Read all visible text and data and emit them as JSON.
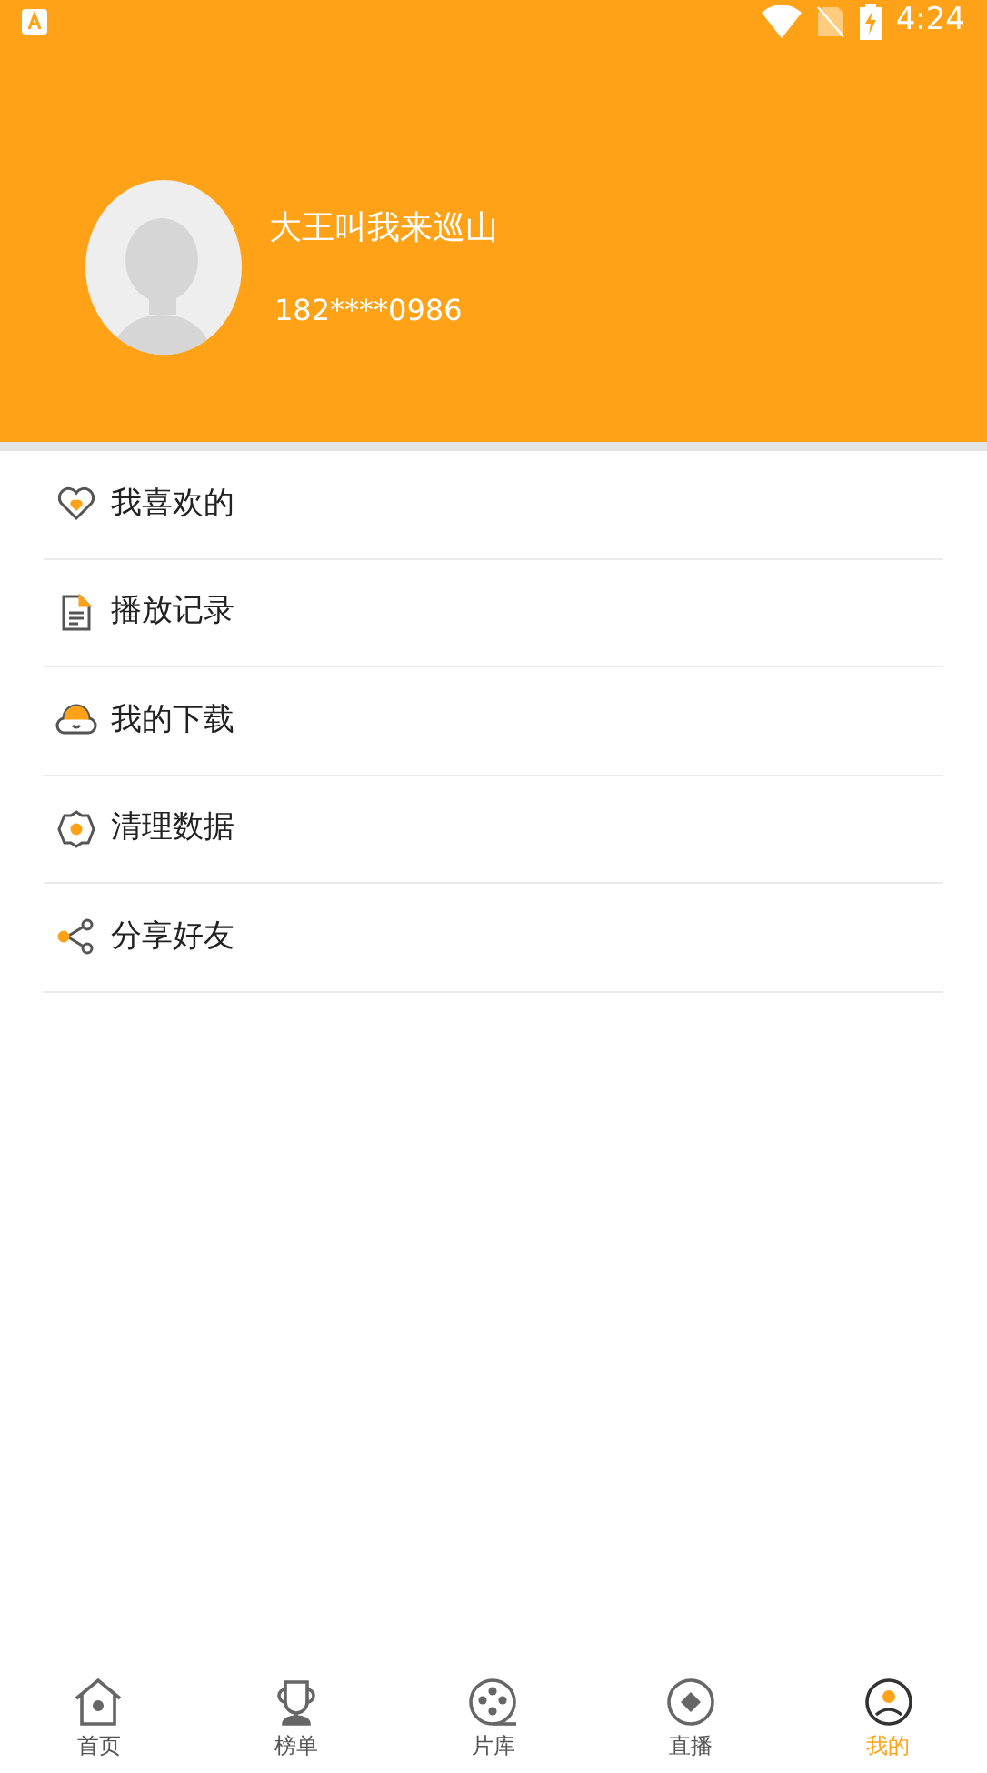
{
  "status_bar": {
    "time": "4:24"
  },
  "profile": {
    "name": "大王叫我来巡山",
    "phone": "182****0986"
  },
  "menu": [
    {
      "label": "我喜欢的"
    },
    {
      "label": "播放记录"
    },
    {
      "label": "我的下载"
    },
    {
      "label": "清理数据"
    },
    {
      "label": "分享好友"
    }
  ],
  "tabs": [
    {
      "label": "首页",
      "selected": false
    },
    {
      "label": "榜单",
      "selected": false
    },
    {
      "label": "片库",
      "selected": false
    },
    {
      "label": "直播",
      "selected": false
    },
    {
      "label": "我的",
      "selected": true
    }
  ]
}
